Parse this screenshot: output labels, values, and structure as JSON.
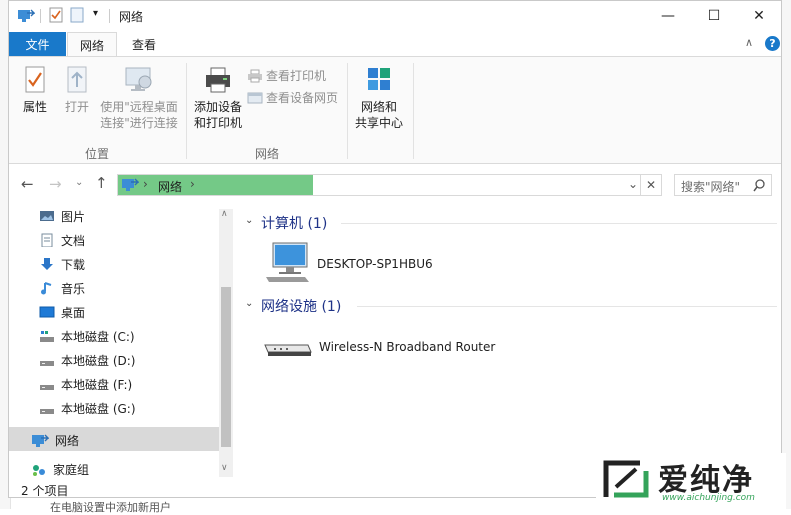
{
  "window": {
    "title": "网络",
    "controls": {
      "minimize": "—",
      "maximize": "☐",
      "close": "✕"
    }
  },
  "ribbon_tabs": {
    "file": "文件",
    "network": "网络",
    "view": "查看"
  },
  "ribbon": {
    "location": {
      "label": "位置",
      "properties": "属性",
      "open": "打开",
      "remote_line1": "使用\"远程桌面",
      "remote_line2": "连接\"进行连接"
    },
    "network": {
      "label": "网络",
      "add_device_line1": "添加设备",
      "add_device_line2": "和打印机",
      "view_printers": "查看打印机",
      "view_webpage": "查看设备网页"
    },
    "sharing_line1": "网络和",
    "sharing_line2": "共享中心"
  },
  "address": {
    "crumb": "网络",
    "search_placeholder": "搜索\"网络\""
  },
  "nav": {
    "items": [
      {
        "label": "图片",
        "icon": "pictures-icon"
      },
      {
        "label": "文档",
        "icon": "documents-icon"
      },
      {
        "label": "下载",
        "icon": "downloads-icon"
      },
      {
        "label": "音乐",
        "icon": "music-icon"
      },
      {
        "label": "桌面",
        "icon": "desktop-icon"
      },
      {
        "label": "本地磁盘 (C:)",
        "icon": "drive-c-icon"
      },
      {
        "label": "本地磁盘 (D:)",
        "icon": "drive-icon"
      },
      {
        "label": "本地磁盘 (F:)",
        "icon": "drive-icon"
      },
      {
        "label": "本地磁盘 (G:)",
        "icon": "drive-icon"
      }
    ],
    "network": "网络",
    "homegroup": "家庭组"
  },
  "content": {
    "computers_header": "计算机 (1)",
    "computer_name": "DESKTOP-SP1HBU6",
    "infra_header": "网络设施 (1)",
    "router_name": "Wireless-N Broadband Router"
  },
  "status": {
    "count": "2 个项目"
  },
  "below_text": "在电脑设置中添加新用户",
  "logo": {
    "text": "爱纯净",
    "url": "www.aichunjing.com"
  },
  "colors": {
    "file_tab": "#1979ca",
    "address_fill": "#74c987",
    "section_header": "#1e3287",
    "help": "#1979ca",
    "logo_green": "#34a35a"
  }
}
